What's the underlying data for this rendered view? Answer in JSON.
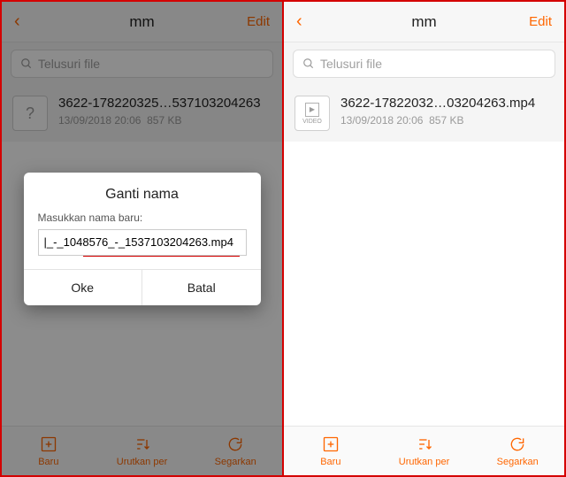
{
  "left": {
    "header": {
      "back_glyph": "‹",
      "title": "mm",
      "edit": "Edit"
    },
    "search": {
      "placeholder": "Telusuri file"
    },
    "file": {
      "name": "3622-178220325…537103204263",
      "date": "13/09/2018 20:06",
      "size": "857 KB"
    },
    "modal": {
      "title": "Ganti nama",
      "label": "Masukkan nama baru:",
      "value": "|_-_1048576_-_1537103204263.mp4",
      "ok": "Oke",
      "cancel": "Batal"
    },
    "bottom": {
      "new": "Baru",
      "sort": "Urutkan per",
      "refresh": "Segarkan"
    }
  },
  "right": {
    "header": {
      "back_glyph": "‹",
      "title": "mm",
      "edit": "Edit"
    },
    "search": {
      "placeholder": "Telusuri file"
    },
    "file": {
      "name_a": "3622-17822032…03204263",
      "name_b": ".mp4",
      "thumb_label": "VIDEO",
      "date": "13/09/2018 20:06",
      "size": "857 KB"
    },
    "bottom": {
      "new": "Baru",
      "sort": "Urutkan per",
      "refresh": "Segarkan"
    }
  }
}
